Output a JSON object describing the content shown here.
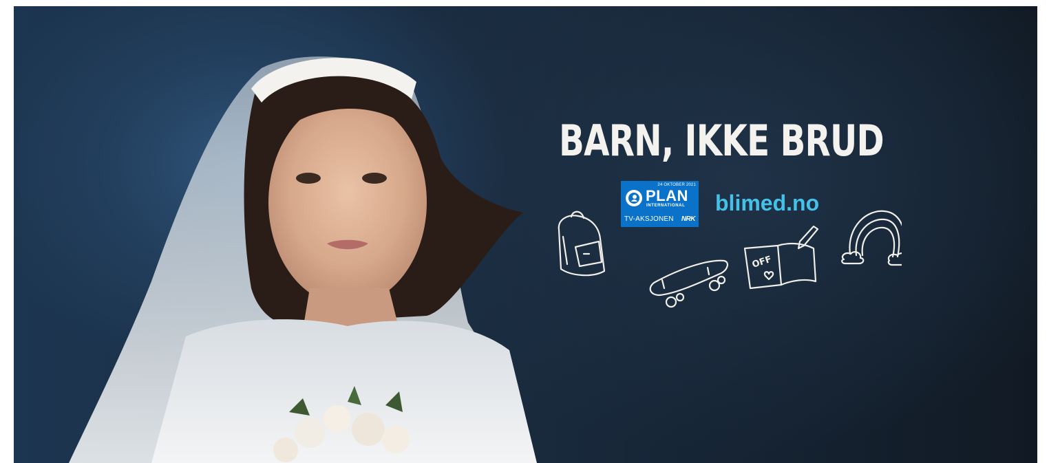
{
  "headline": "BARN, IKKE BRUD",
  "logo": {
    "date": "24 OKTOBER 2021",
    "name": "PLAN",
    "subtitle": "INTERNATIONAL",
    "campaign": "TV-AKSJONEN",
    "broadcaster": "NRK"
  },
  "website": "blimed.no",
  "doodles": {
    "notebook_text": "OFF"
  },
  "colors": {
    "background": "#1a2c40",
    "headline": "#f4f2ee",
    "logo_blue": "#0a72c8",
    "url": "#45c0e8"
  },
  "icons": [
    "backpack-icon",
    "skateboard-icon",
    "notebook-icon",
    "rainbow-icon",
    "plan-globe-icon"
  ]
}
